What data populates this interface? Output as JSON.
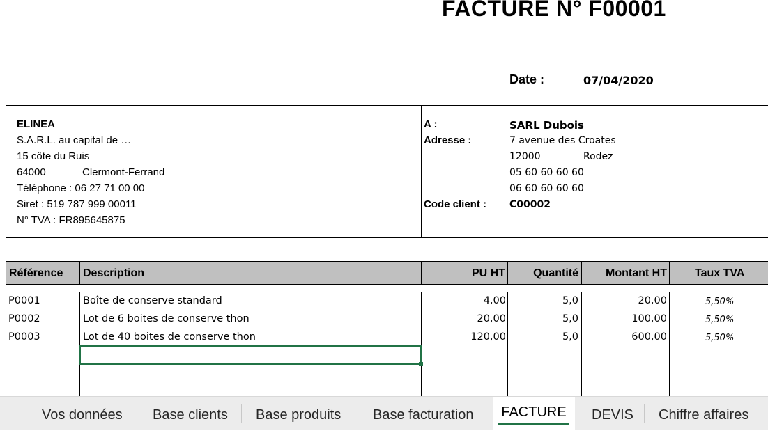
{
  "invoice": {
    "title": "FACTURE N° F00001",
    "date_label": "Date :",
    "date_value": "07/04/2020"
  },
  "seller": {
    "name": "ELINEA",
    "legal": "S.A.R.L. au capital de …",
    "street": "15 côte du Ruis",
    "postcode": "64000",
    "city": "Clermont-Ferrand",
    "phone": "Téléphone : 06 27 71 00 00",
    "siret": "Siret : 519 787 999 00011",
    "tva": "N° TVA : FR895645875"
  },
  "client": {
    "to_label": "A :",
    "address_label": "Adresse :",
    "code_label": "Code client :",
    "name": "SARL Dubois",
    "street": "7 avenue des Croates",
    "postcode": "12000",
    "city": "Rodez",
    "phone1": "05 60 60 60 60",
    "phone2": "06 60 60 60 60",
    "code": "C00002"
  },
  "table": {
    "headers": [
      "Référence",
      "Description",
      "PU HT",
      "Quantité",
      "Montant HT",
      "Taux TVA"
    ],
    "rows": [
      {
        "ref": "P0001",
        "desc": "Boîte de conserve standard",
        "pu": "4,00",
        "qty": "5,0",
        "amount": "20,00",
        "tva": "5,50%"
      },
      {
        "ref": "P0002",
        "desc": "Lot de 6 boites de conserve thon",
        "pu": "20,00",
        "qty": "5,0",
        "amount": "100,00",
        "tva": "5,50%"
      },
      {
        "ref": "P0003",
        "desc": "Lot de 40 boites de conserve thon",
        "pu": "120,00",
        "qty": "5,0",
        "amount": "600,00",
        "tva": "5,50%"
      }
    ]
  },
  "tabs": {
    "items": [
      "Vos données",
      "Base clients",
      "Base produits",
      "Base facturation",
      "FACTURE",
      "DEVIS",
      "Chiffre affaires"
    ],
    "active": "FACTURE"
  },
  "colors": {
    "accent": "#217346",
    "header_bg": "#c0c0c0",
    "tabbar_bg": "#ececec"
  }
}
